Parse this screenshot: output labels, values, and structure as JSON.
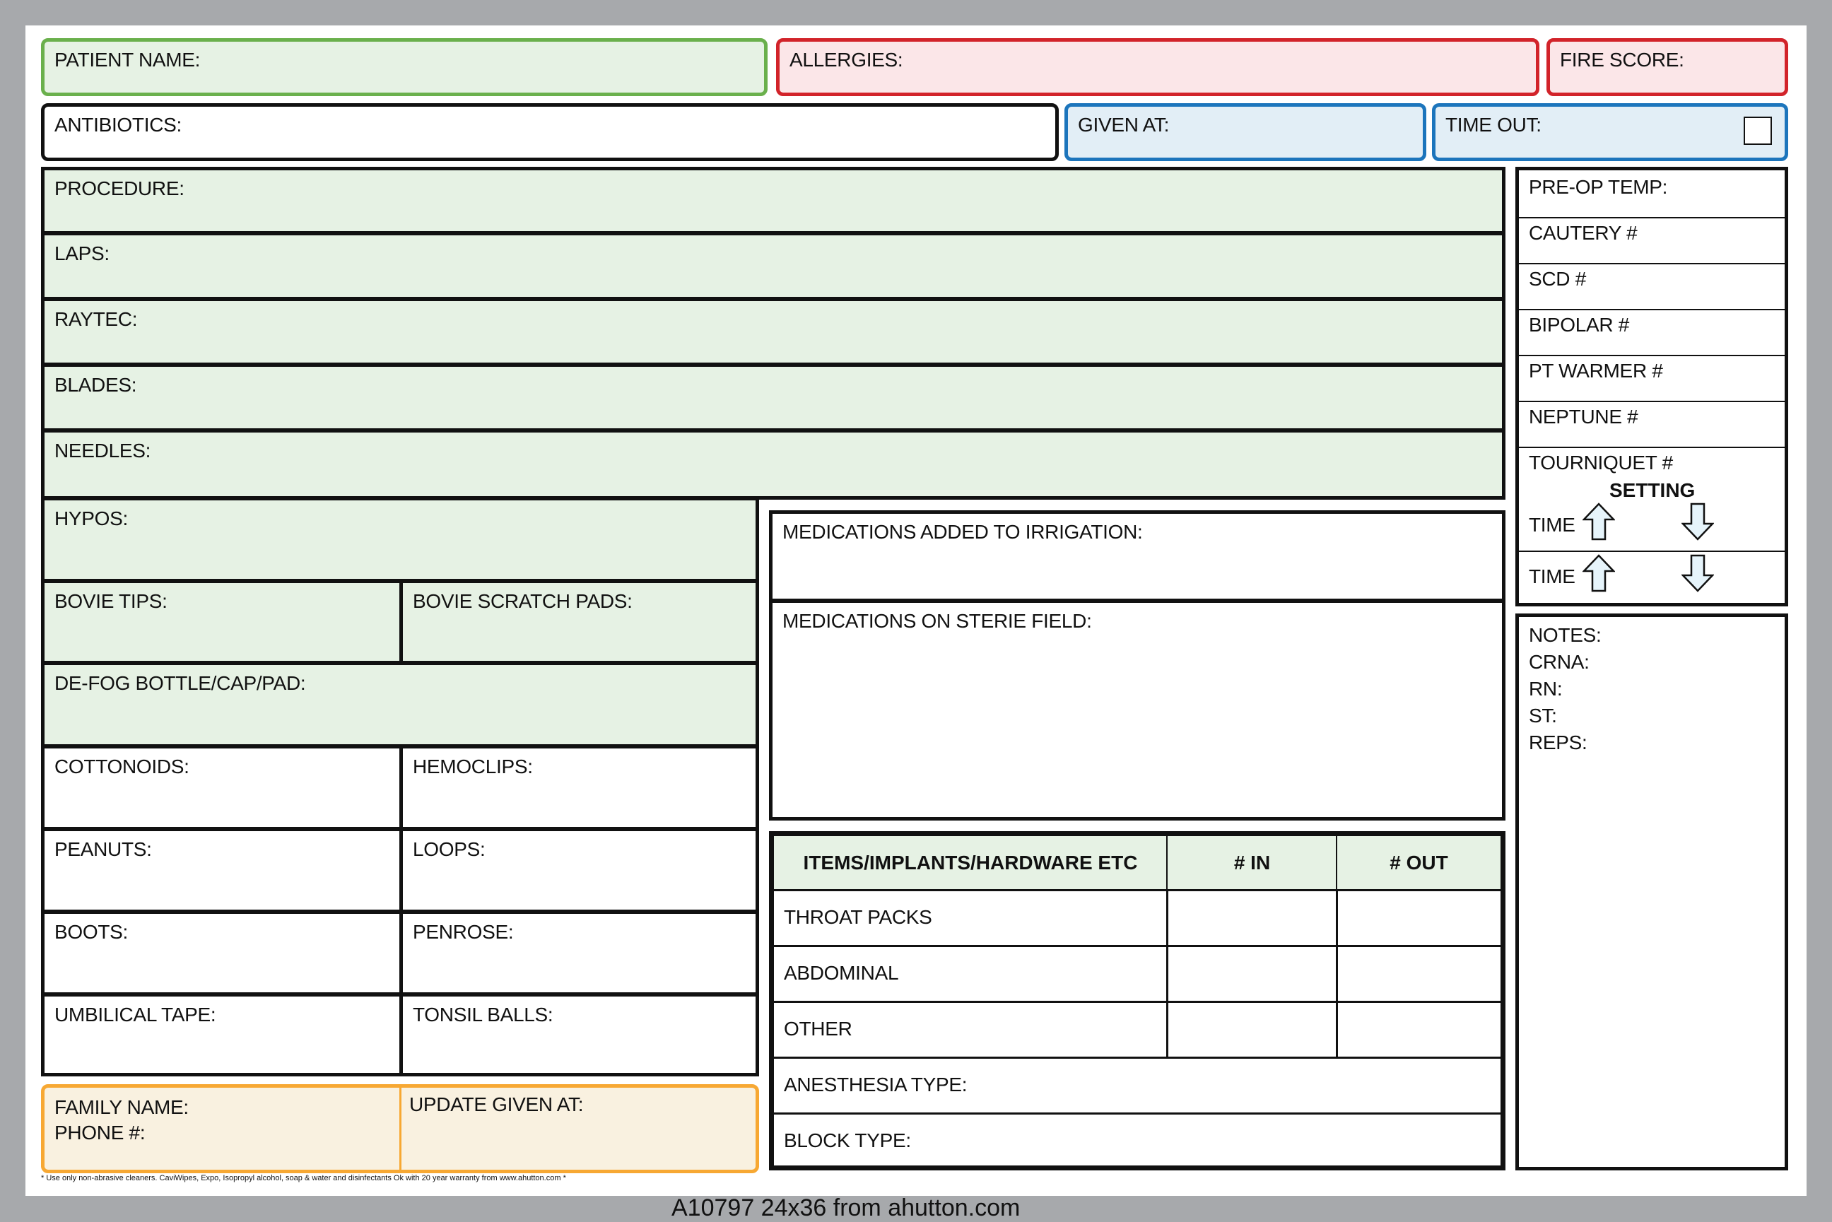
{
  "header": {
    "patient_name": "PATIENT NAME:",
    "allergies": "ALLERGIES:",
    "fire_score": "FIRE SCORE:",
    "antibiotics": "ANTIBIOTICS:",
    "given_at": "GIVEN AT:",
    "time_out": "TIME OUT:"
  },
  "supplies": {
    "procedure": "PROCEDURE:",
    "laps": "LAPS:",
    "raytec": "RAYTEC:",
    "blades": "BLADES:",
    "needles": "NEEDLES:",
    "hypos": "HYPOS:",
    "bovie_tips": "BOVIE TIPS:",
    "bovie_scratch_pads": "BOVIE SCRATCH PADS:",
    "defog": "DE-FOG BOTTLE/CAP/PAD:",
    "cottonoids": "COTTONOIDS:",
    "hemoclips": "HEMOCLIPS:",
    "peanuts": "PEANUTS:",
    "loops": "LOOPS:",
    "boots": "BOOTS:",
    "penrose": "PENROSE:",
    "umbilical_tape": "UMBILICAL TAPE:",
    "tonsil_balls": "TONSIL BALLS:"
  },
  "family": {
    "family_name": "FAMILY NAME:",
    "phone": "PHONE #:",
    "update_given_at": "UPDATE GIVEN AT:"
  },
  "medications": {
    "irrigation": "MEDICATIONS ADDED TO IRRIGATION:",
    "sterile_field": "MEDICATIONS ON STERIE FIELD:"
  },
  "items_table": {
    "headers": [
      "ITEMS/IMPLANTS/HARDWARE ETC",
      "# IN",
      "# OUT"
    ],
    "rows": [
      "THROAT PACKS",
      "ABDOMINAL",
      "OTHER"
    ],
    "anesthesia_type": "ANESTHESIA TYPE:",
    "block_type": "BLOCK TYPE:"
  },
  "equipment": {
    "pre_op_temp": "PRE-OP TEMP:",
    "cautery": "CAUTERY #",
    "scd": "SCD #",
    "bipolar": "BIPOLAR #",
    "pt_warmer": "PT WARMER #",
    "neptune": "NEPTUNE #",
    "tourniquet": "TOURNIQUET #",
    "setting": "SETTING",
    "time_1": "TIME",
    "time_2": "TIME"
  },
  "notes": {
    "notes": "NOTES:",
    "crna": "CRNA:",
    "rn": "RN:",
    "st": "ST:",
    "reps": "REPS:"
  },
  "footer": {
    "disclaimer": "* Use only non-abrasive cleaners. CaviWipes, Expo, Isopropyl alcohol, soap & water and disinfectants Ok with 20 year warranty from www.ahutton.com *",
    "product_caption": "A10797  24x36  from ahutton.com"
  },
  "colors": {
    "green_border": "#6ab04c",
    "red_border": "#d2232a",
    "blue_border": "#1c75bc",
    "orange_border": "#f7a833",
    "green_fill": "#e6f2e4",
    "pink_fill": "#fbe6e8",
    "blue_fill": "#e2eef6",
    "tan_fill": "#f9f1e0"
  }
}
